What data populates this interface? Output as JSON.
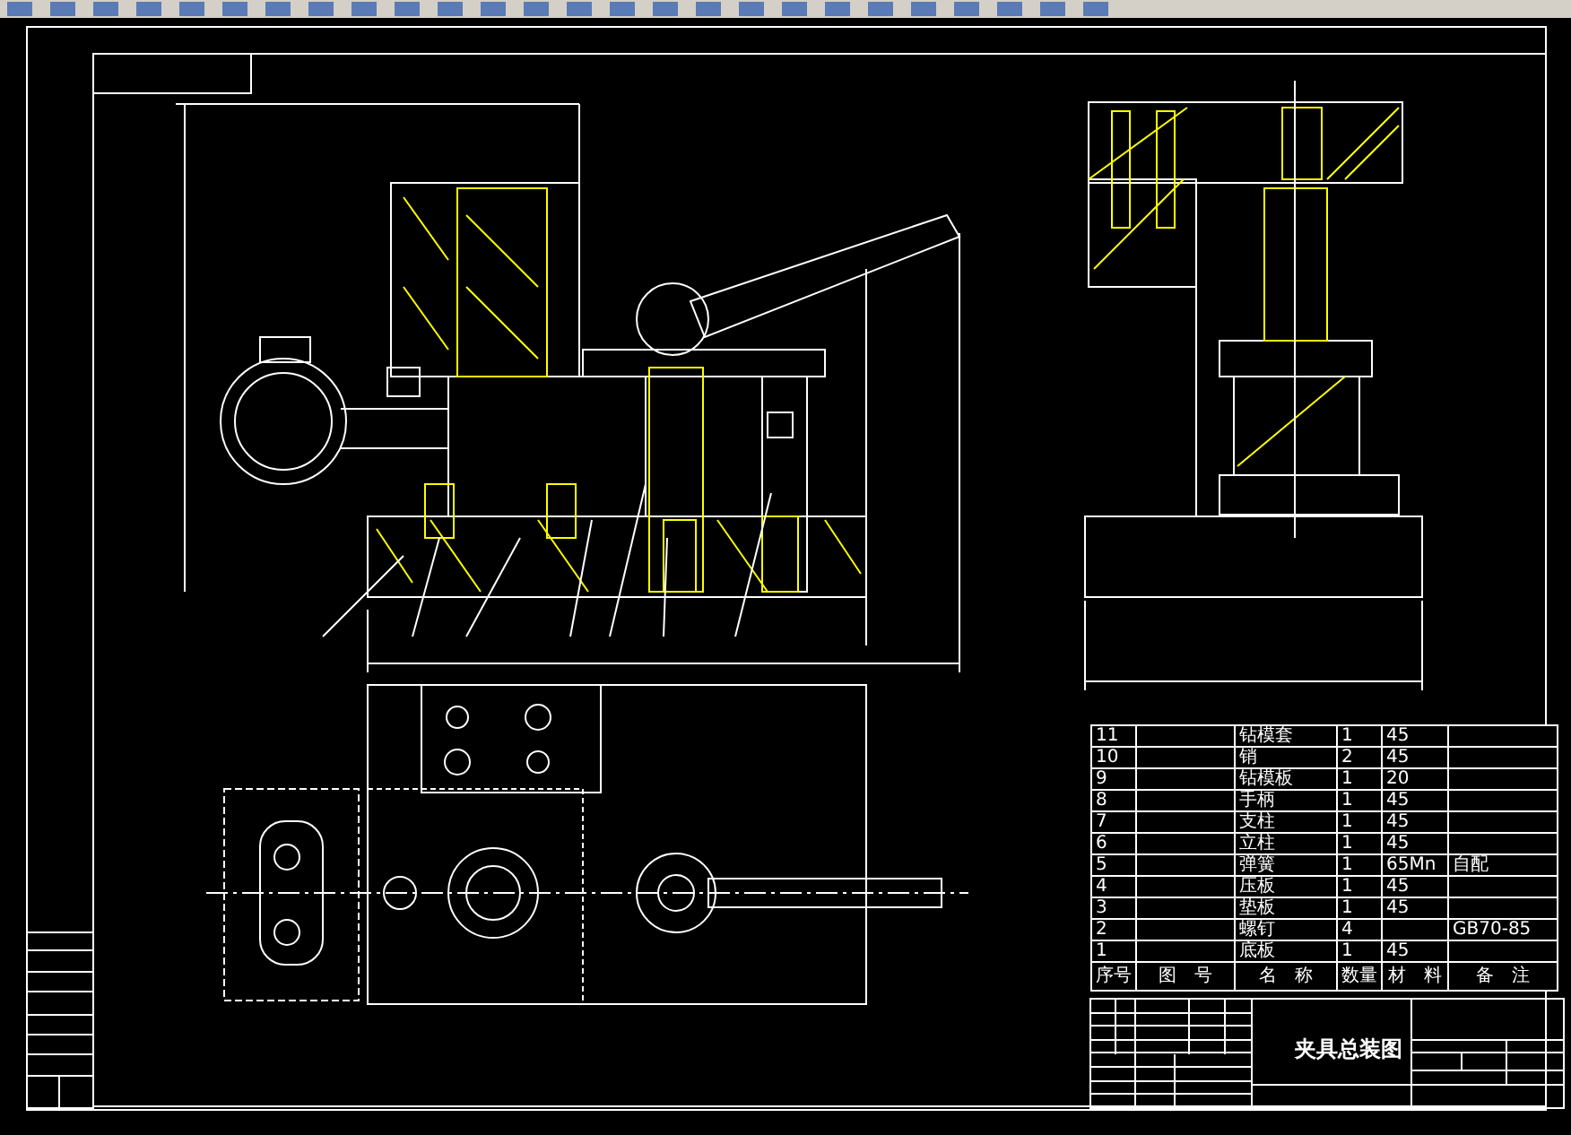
{
  "bom": {
    "columns": [
      "序号",
      "图　号",
      "名　称",
      "数量",
      "材　料",
      "备　注"
    ],
    "rows": [
      {
        "no": "11",
        "name": "钻模套",
        "qty": "1",
        "material": "45",
        "note": ""
      },
      {
        "no": "10",
        "name": "销",
        "qty": "2",
        "material": "45",
        "note": ""
      },
      {
        "no": "9",
        "name": "钻模板",
        "qty": "1",
        "material": "20",
        "note": ""
      },
      {
        "no": "8",
        "name": "手柄",
        "qty": "1",
        "material": "45",
        "note": ""
      },
      {
        "no": "7",
        "name": "支柱",
        "qty": "1",
        "material": "45",
        "note": ""
      },
      {
        "no": "6",
        "name": "立柱",
        "qty": "1",
        "material": "45",
        "note": ""
      },
      {
        "no": "5",
        "name": "弹簧",
        "qty": "1",
        "material": "65Mn",
        "note": "自配"
      },
      {
        "no": "4",
        "name": "压板",
        "qty": "1",
        "material": "45",
        "note": ""
      },
      {
        "no": "3",
        "name": "垫板",
        "qty": "1",
        "material": "45",
        "note": ""
      },
      {
        "no": "2",
        "name": "螺钉",
        "qty": "4",
        "material": "",
        "note": "GB70-85"
      },
      {
        "no": "1",
        "name": "底板",
        "qty": "1",
        "material": "45",
        "note": ""
      }
    ]
  },
  "title_block": {
    "title": "夹具总装图"
  }
}
